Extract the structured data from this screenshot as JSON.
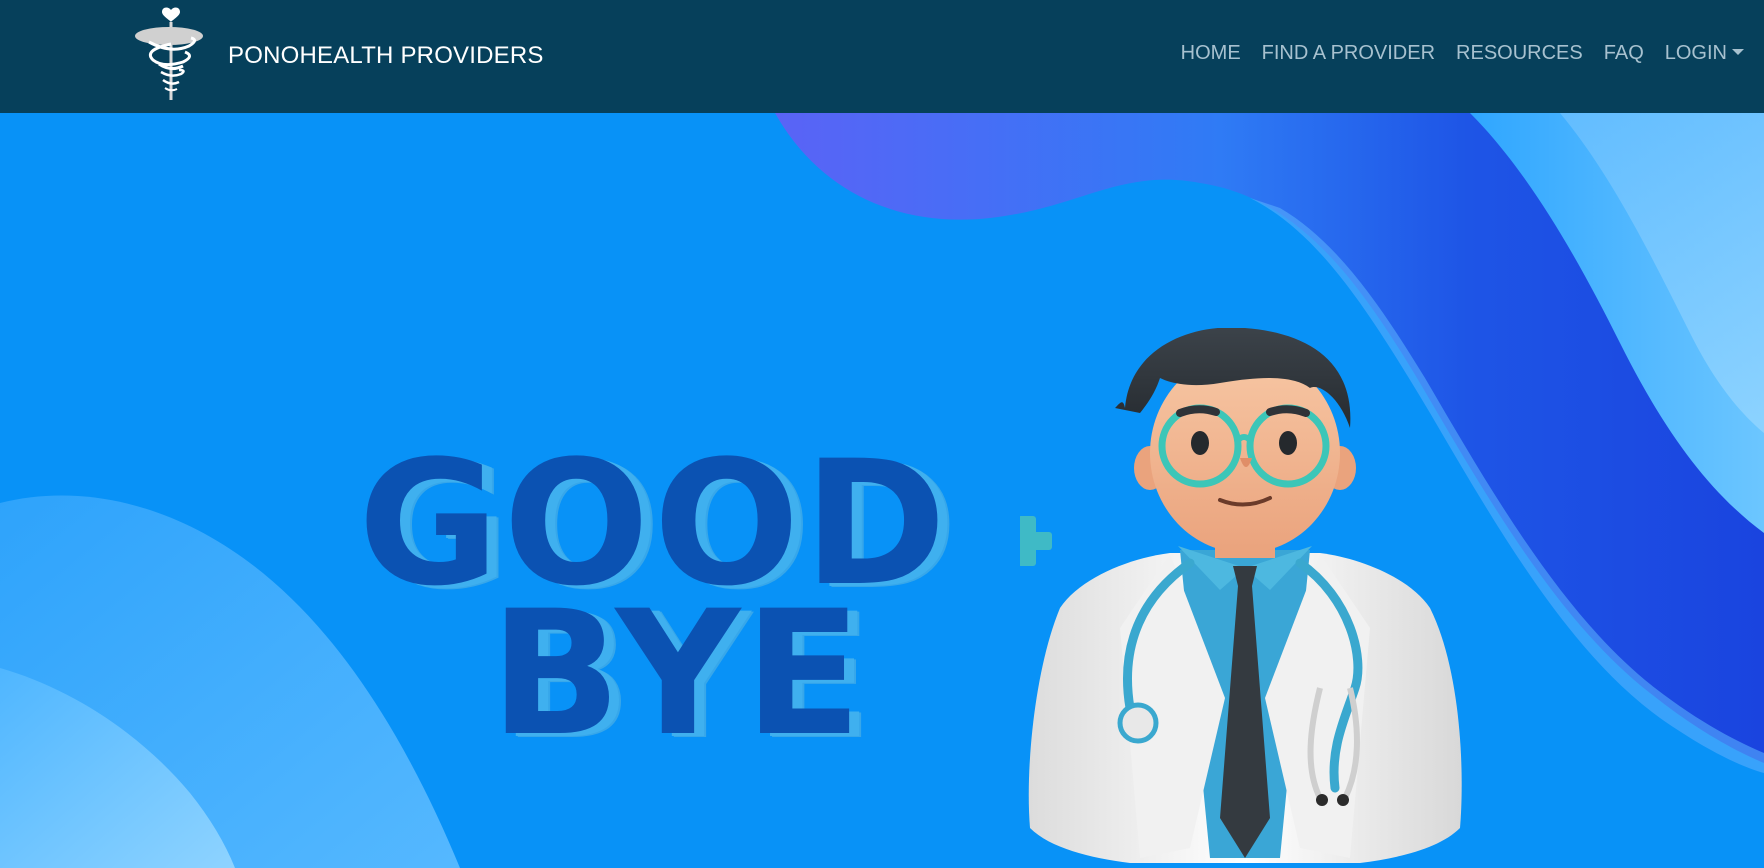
{
  "app": {
    "brand_name": "PONOHEALTH PROVIDERS",
    "logo_icon": "caduceus-heart-icon"
  },
  "nav": {
    "items": [
      {
        "label": "HOME"
      },
      {
        "label": "FIND A PROVIDER"
      },
      {
        "label": "RESOURCES"
      },
      {
        "label": "FAQ"
      }
    ],
    "login_label": "LOGIN"
  },
  "hero": {
    "line1": "GOOD",
    "line2": "BYE",
    "illustration": "doctor-illustration",
    "cross_icon": "medical-cross-icon"
  },
  "colors": {
    "navbar": "#06405b",
    "nav_text": "#a7c1cf",
    "hero_bg": "#0892f7",
    "headline": "#0b52b2",
    "headline_shadow": "#3fb0ef"
  }
}
